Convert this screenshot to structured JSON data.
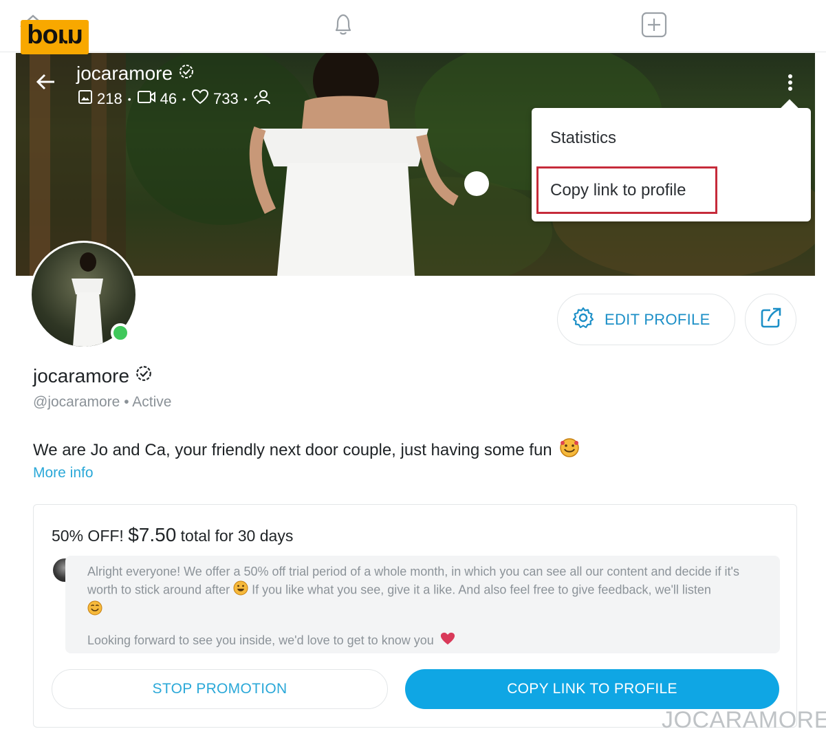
{
  "logo": {
    "text": "porn"
  },
  "cover": {
    "username": "jocaramore",
    "stats": {
      "photos": "218",
      "videos": "46",
      "likes": "733"
    }
  },
  "menu": {
    "items": [
      {
        "label": "Statistics"
      },
      {
        "label": "Copy link to profile"
      }
    ]
  },
  "actions": {
    "edit_profile": "EDIT PROFILE"
  },
  "profile": {
    "name": "jocaramore",
    "handle": "@jocaramore",
    "status": "Active",
    "bio": "We are Jo and Ca, your friendly next door couple, just having some fun",
    "more_info": "More info"
  },
  "promotion": {
    "title_prefix": "50% OFF!",
    "price": "$7.50",
    "title_suffix": "total for 30 days",
    "message_line1": "Alright everyone! We offer a 50% off trial period of a whole month, in which you can see all our content and decide if it's worth to stick around after",
    "message_line1b": "If you like what you see, give it a like. And also feel free to give feedback, we'll listen",
    "message_line2": "Looking forward to see you inside, we'd love to get to know you",
    "stop_button": "STOP PROMOTION",
    "copy_button": "COPY LINK TO PROFILE"
  },
  "watermark": "JOCARAMORE",
  "colors": {
    "accent": "#0fa6e4",
    "link": "#2aa8d8",
    "online": "#40c85b",
    "highlight": "#c62b3a",
    "logo_bg": "#f8a800"
  }
}
